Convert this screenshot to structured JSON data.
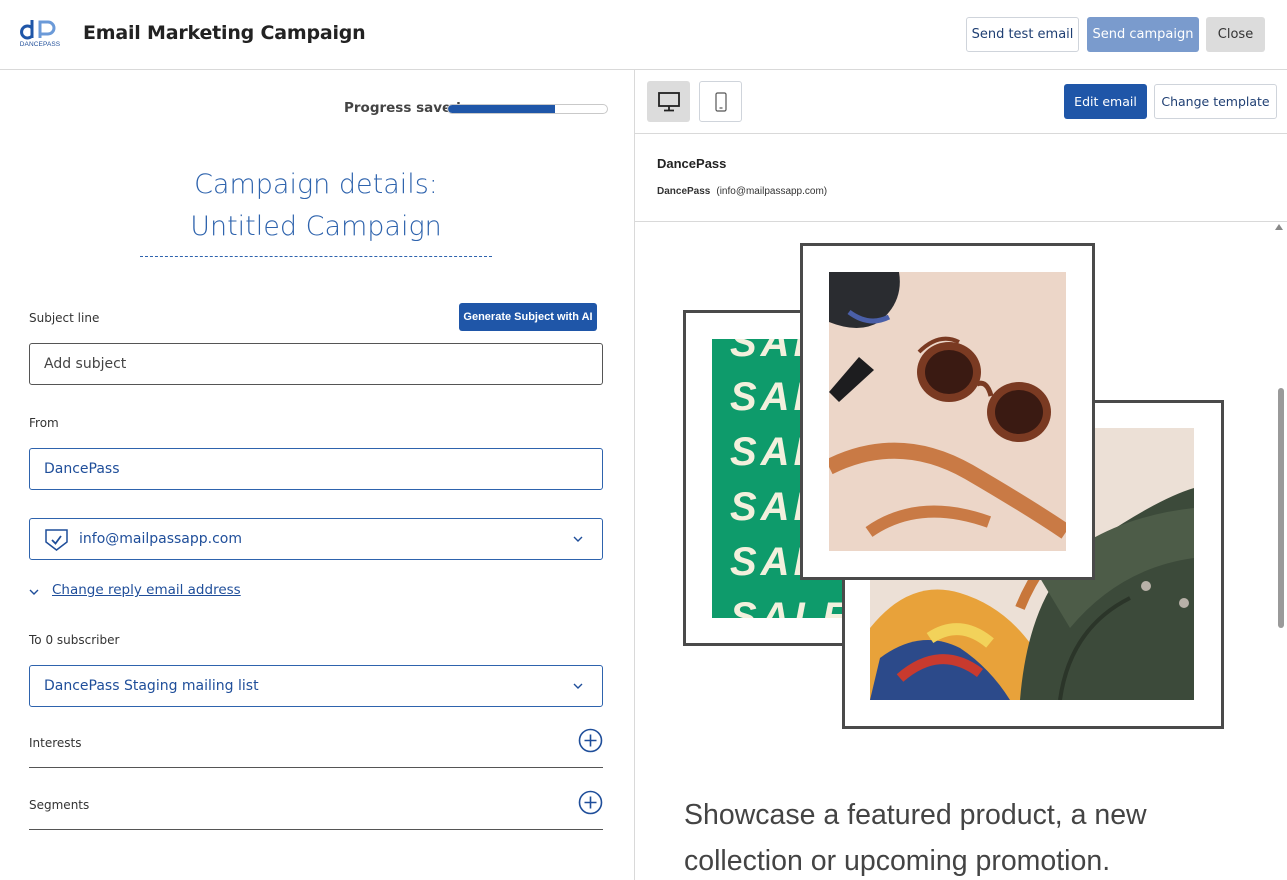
{
  "header": {
    "logo_text": "DANCEPASS",
    "title": "Email Marketing Campaign",
    "send_test_label": "Send test email",
    "send_campaign_label": "Send campaign",
    "close_label": "Close"
  },
  "progress": {
    "label": "Progress saved",
    "value_percent": 67
  },
  "campaign": {
    "title_line1": "Campaign details:",
    "title_line2": "Untitled Campaign"
  },
  "subject": {
    "label": "Subject line",
    "ai_button_label": "Generate Subject with AI",
    "placeholder": "Add subject"
  },
  "from": {
    "label": "From",
    "name_value": "DancePass",
    "email_value": "info@mailpassapp.com",
    "reply_link": "Change reply email address"
  },
  "to": {
    "label": "To 0 subscriber",
    "list_value": "DancePass Staging mailing list"
  },
  "accordions": {
    "interests_label": "Interests",
    "segments_label": "Segments"
  },
  "preview_toolbar": {
    "edit_label": "Edit email",
    "template_label": "Change template"
  },
  "preview_sender": {
    "name": "DancePass",
    "sub_name": "DancePass",
    "sub_email": "(info@mailpassapp.com)"
  },
  "preview_content": {
    "sale_words": [
      "SALE",
      "SALE",
      "SALE",
      "SALE",
      "SALE",
      "SALE"
    ],
    "headline": "Showcase a featured product, a new collection or upcoming promotion."
  },
  "colors": {
    "brand_blue": "#1f56a8",
    "link_blue": "#2e63ad",
    "sale_green": "#0e9b6b"
  },
  "icons": {
    "desktop": "desktop-icon",
    "mobile": "mobile-icon",
    "verified": "shield-check-icon",
    "chevron": "chevron-down-icon",
    "plus": "plus-circle-icon"
  }
}
